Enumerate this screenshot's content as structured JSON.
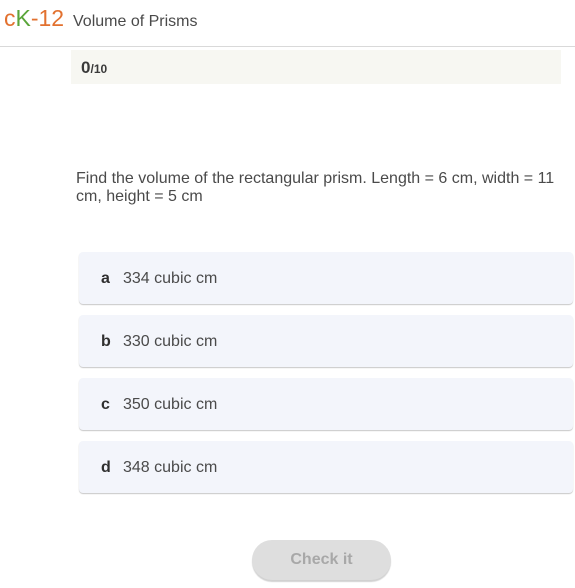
{
  "header": {
    "logo": {
      "c": "c",
      "k": "K",
      "dash": "-",
      "num": "12"
    },
    "title": "Volume of Prisms"
  },
  "score": {
    "got": "0",
    "slash": "/",
    "total": "10"
  },
  "question": {
    "text": "Find the volume of the rectangular prism. Length = 6 cm, width = 11 cm, height = 5 cm"
  },
  "options": [
    {
      "letter": "a",
      "text": "334 cubic cm"
    },
    {
      "letter": "b",
      "text": "330 cubic cm"
    },
    {
      "letter": "c",
      "text": "350 cubic cm"
    },
    {
      "letter": "d",
      "text": "348 cubic cm"
    }
  ],
  "check_button": {
    "label": "Check it"
  },
  "colors": {
    "logo_orange": "#e2712f",
    "logo_green": "#5aa53a",
    "option_bg": "#f3f5fb",
    "score_bg": "#f7f7f2",
    "button_bg": "#dedede",
    "button_text": "#a8a8a8"
  }
}
